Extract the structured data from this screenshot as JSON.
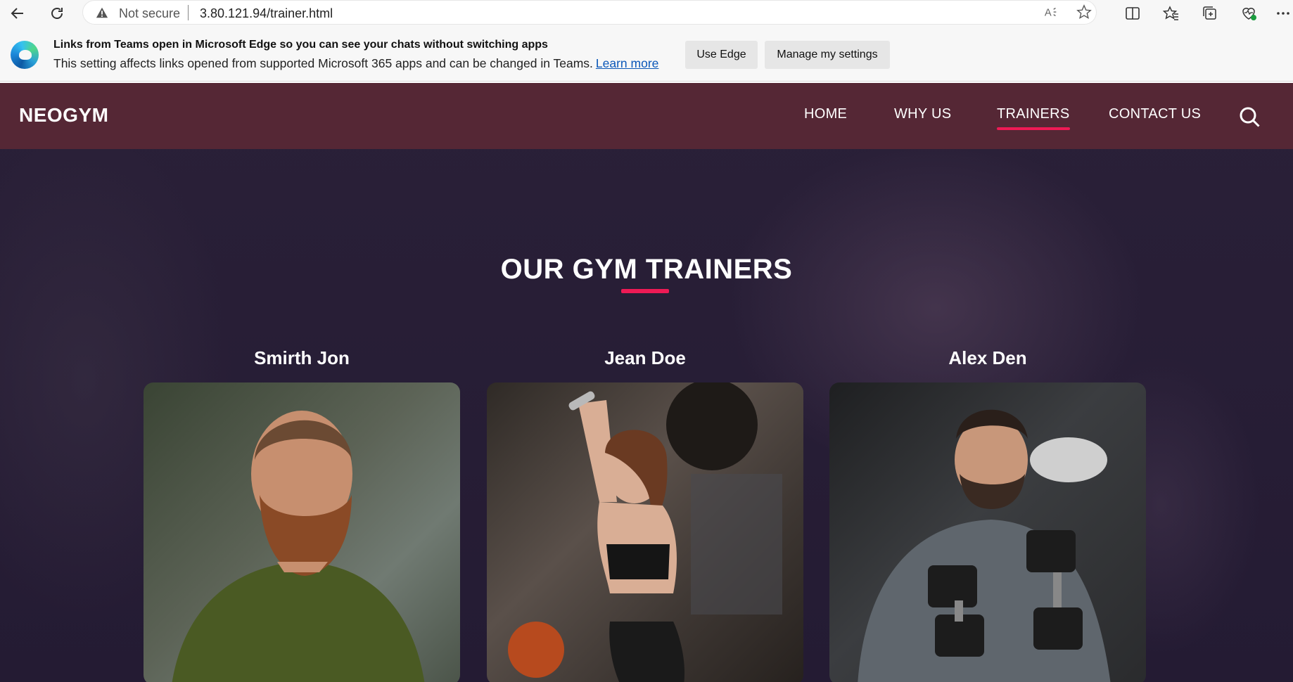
{
  "browser": {
    "not_secure": "Not secure",
    "url": "3.80.121.94/trainer.html"
  },
  "infobar": {
    "title": "Links from Teams open in Microsoft Edge so you can see your chats without switching apps",
    "text": "This setting affects links opened from supported Microsoft 365 apps and can be changed in Teams.",
    "learn_more": "Learn more",
    "use_edge": "Use Edge",
    "manage": "Manage my settings"
  },
  "site": {
    "brand": "NEOGYM",
    "nav": [
      {
        "label": "HOME"
      },
      {
        "label": "WHY US"
      },
      {
        "label": "TRAINERS"
      },
      {
        "label": "CONTACT US"
      }
    ],
    "heading": "OUR GYM TRAINERS",
    "trainers": [
      {
        "name": "Smirth Jon"
      },
      {
        "name": "Jean Doe"
      },
      {
        "name": "Alex Den"
      }
    ]
  },
  "colors": {
    "navbar": "#552735",
    "accent": "#ee1a55",
    "page_bg": "#241b33"
  }
}
